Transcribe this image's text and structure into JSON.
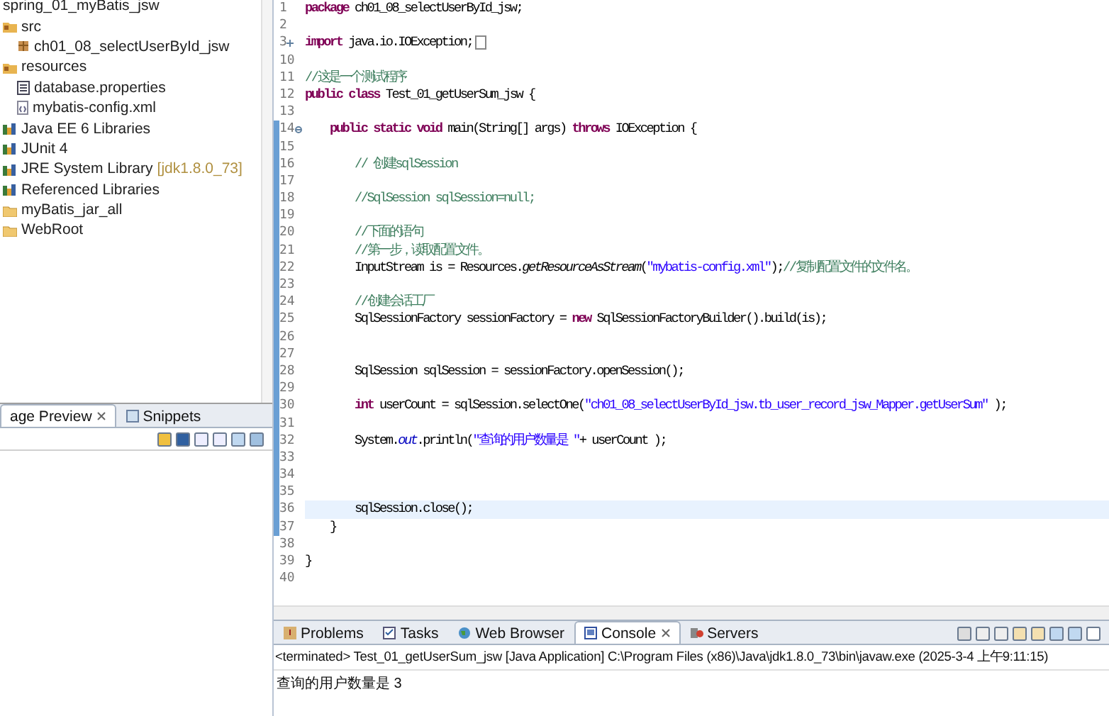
{
  "explorer": {
    "items": [
      {
        "label": "spring_01_myBatis_jsw",
        "kind": "project",
        "children": [
          {
            "label": "src",
            "kind": "source-folder",
            "children": [
              {
                "label": "ch01_08_selectUserById_jsw",
                "kind": "package"
              }
            ]
          },
          {
            "label": "resources",
            "kind": "source-folder",
            "children": [
              {
                "label": "database.properties",
                "kind": "properties-file"
              },
              {
                "label": "mybatis-config.xml",
                "kind": "xml-file"
              }
            ]
          },
          {
            "label": "Java EE 6 Libraries",
            "kind": "library"
          },
          {
            "label": "JUnit 4",
            "kind": "library"
          },
          {
            "label": "JRE System Library",
            "kind": "library",
            "decoration": "[jdk1.8.0_73]"
          },
          {
            "label": "Referenced Libraries",
            "kind": "library"
          },
          {
            "label": "myBatis_jar_all",
            "kind": "folder"
          },
          {
            "label": "WebRoot",
            "kind": "folder"
          }
        ]
      }
    ]
  },
  "preview_view": {
    "tabs": [
      {
        "label": "age Preview",
        "selected": true
      },
      {
        "label": "Snippets",
        "selected": false
      }
    ]
  },
  "editor": {
    "lines": [
      {
        "number": "1",
        "current": false,
        "tokens": [
          {
            "kind": "keyword",
            "text": "package"
          },
          {
            "kind": "plain",
            "text": " ch01_08_selectUserById_jsw;"
          }
        ]
      },
      {
        "number": "2",
        "current": false
      },
      {
        "number": "3",
        "current": false,
        "folded": true,
        "tokens": [
          {
            "kind": "keyword",
            "text": "import"
          },
          {
            "kind": "plain",
            "text": " java.io.IOException;"
          }
        ]
      },
      {
        "number": "10",
        "current": false
      },
      {
        "number": "11",
        "current": false,
        "tokens": [
          {
            "kind": "comment",
            "text": "//这是一个测试程序"
          }
        ]
      },
      {
        "number": "12",
        "current": false,
        "tokens": [
          {
            "kind": "keyword",
            "text": "public class"
          },
          {
            "kind": "plain",
            "text": " Test_01_getUserSum_jsw {"
          }
        ]
      },
      {
        "number": "13",
        "current": false
      },
      {
        "number": "14",
        "current": false,
        "folded": false,
        "tokens": [
          {
            "kind": "keyword",
            "text": "\tpublic static void"
          },
          {
            "kind": "plain",
            "text": " main(String[] args) "
          },
          {
            "kind": "keyword",
            "text": "throws"
          },
          {
            "kind": "plain",
            "text": " IOException {"
          }
        ]
      },
      {
        "number": "15",
        "current": false
      },
      {
        "number": "16",
        "current": false,
        "tokens": [
          {
            "kind": "comment",
            "text": "\t\t// 创建sqlSession"
          }
        ]
      },
      {
        "number": "17",
        "current": false
      },
      {
        "number": "18",
        "current": false,
        "tokens": [
          {
            "kind": "comment",
            "text": "\t\t//SqlSession sqlSession=null;"
          }
        ]
      },
      {
        "number": "19",
        "current": false
      },
      {
        "number": "20",
        "current": false,
        "tokens": [
          {
            "kind": "comment",
            "text": "\t\t//下面的语句"
          }
        ]
      },
      {
        "number": "21",
        "current": false,
        "tokens": [
          {
            "kind": "comment",
            "text": "\t\t//第一步，读取配置文件。"
          }
        ]
      },
      {
        "number": "22",
        "current": false,
        "tokens": [
          {
            "kind": "plain",
            "text": "\t\tInputStream is = Resources."
          },
          {
            "kind": "method",
            "text": "getResourceAsStream"
          },
          {
            "kind": "plain",
            "text": "("
          },
          {
            "kind": "string",
            "text": "\"mybatis-config.xml\""
          },
          {
            "kind": "plain",
            "text": ");"
          },
          {
            "kind": "comment",
            "text": "//复制配置文件的文件名。"
          }
        ]
      },
      {
        "number": "23",
        "current": false
      },
      {
        "number": "24",
        "current": false,
        "tokens": [
          {
            "kind": "comment",
            "text": "\t\t//创建会话工厂"
          }
        ]
      },
      {
        "number": "25",
        "current": false,
        "tokens": [
          {
            "kind": "plain",
            "text": "\t\tSqlSessionFactory sessionFactory = "
          },
          {
            "kind": "keyword",
            "text": "new"
          },
          {
            "kind": "plain",
            "text": " SqlSessionFactoryBuilder().build(is);"
          }
        ]
      },
      {
        "number": "26",
        "current": false
      },
      {
        "number": "27",
        "current": false
      },
      {
        "number": "28",
        "current": false,
        "tokens": [
          {
            "kind": "plain",
            "text": "\t\tSqlSession sqlSession = sessionFactory.openSession();"
          }
        ]
      },
      {
        "number": "29",
        "current": false
      },
      {
        "number": "30",
        "current": false,
        "tokens": [
          {
            "kind": "keyword",
            "text": "\t\tint"
          },
          {
            "kind": "plain",
            "text": " userCount = sqlSession.selectOne("
          },
          {
            "kind": "string",
            "text": "\"ch01_08_selectUserById_jsw.tb_user_record_jsw_Mapper.getUserSum\""
          },
          {
            "kind": "plain",
            "text": " );"
          }
        ]
      },
      {
        "number": "31",
        "current": false
      },
      {
        "number": "32",
        "current": false,
        "tokens": [
          {
            "kind": "plain",
            "text": "\t\tSystem."
          },
          {
            "kind": "field",
            "text": "out"
          },
          {
            "kind": "plain",
            "text": ".println("
          },
          {
            "kind": "string",
            "text": "\"查询的用户数量是 \""
          },
          {
            "kind": "plain",
            "text": "+ userCount );"
          }
        ]
      },
      {
        "number": "33",
        "current": false
      },
      {
        "number": "34",
        "current": false
      },
      {
        "number": "35",
        "current": false
      },
      {
        "number": "36",
        "current": true,
        "tokens": [
          {
            "kind": "plain",
            "text": "\t\tsqlSession.close();"
          }
        ]
      },
      {
        "number": "37",
        "current": false,
        "tokens": [
          {
            "kind": "plain",
            "text": "\t}"
          }
        ]
      },
      {
        "number": "38",
        "current": false
      },
      {
        "number": "39",
        "current": false,
        "tokens": [
          {
            "kind": "plain",
            "text": "}"
          }
        ]
      },
      {
        "number": "40",
        "current": false
      }
    ]
  },
  "console": {
    "tabs": [
      {
        "label": "Problems",
        "selected": false
      },
      {
        "label": "Tasks",
        "selected": false
      },
      {
        "label": "Web Browser",
        "selected": false
      },
      {
        "label": "Console",
        "selected": true
      },
      {
        "label": "Servers",
        "selected": false
      }
    ],
    "header": "<terminated> Test_01_getUserSum_jsw [Java Application] C:\\Program Files (x86)\\Java\\jdk1.8.0_73\\bin\\javaw.exe (2025-3-4 上午9:11:15)",
    "output": "查询的用户数量是 3"
  }
}
